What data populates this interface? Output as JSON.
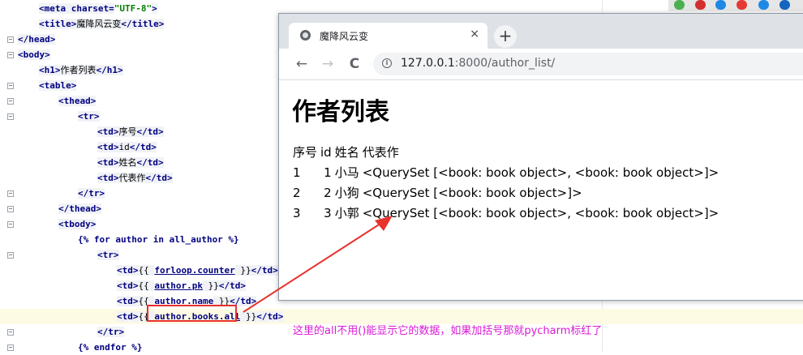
{
  "editor": {
    "lines": [
      {
        "segments": [
          {
            "t": "<meta charset=",
            "c": "tag"
          },
          {
            "t": "\"UTF-8\"",
            "c": "str"
          },
          {
            "t": ">",
            "c": "tag"
          }
        ]
      },
      {
        "segments": [
          {
            "t": "<title>",
            "c": "tag"
          },
          {
            "t": "魔降风云变",
            "c": "txt"
          },
          {
            "t": "</title>",
            "c": "tag"
          }
        ]
      },
      {
        "segments": [
          {
            "t": "</head>",
            "c": "tag"
          }
        ]
      },
      {
        "segments": [
          {
            "t": "<body>",
            "c": "tag"
          }
        ]
      },
      {
        "segments": [
          {
            "t": "<h1>",
            "c": "tag"
          },
          {
            "t": "作者列表",
            "c": "txt"
          },
          {
            "t": "</h1>",
            "c": "tag"
          }
        ]
      },
      {
        "segments": [
          {
            "t": "<table>",
            "c": "tag"
          }
        ]
      },
      {
        "segments": [
          {
            "t": "<thead>",
            "c": "tag"
          }
        ]
      },
      {
        "segments": [
          {
            "t": "<tr>",
            "c": "tag"
          }
        ]
      },
      {
        "segments": [
          {
            "t": "<td>",
            "c": "tag"
          },
          {
            "t": "序号",
            "c": "txt"
          },
          {
            "t": "</td>",
            "c": "tag"
          }
        ]
      },
      {
        "segments": [
          {
            "t": "<td>",
            "c": "tag"
          },
          {
            "t": "id",
            "c": "txt"
          },
          {
            "t": "</td>",
            "c": "tag"
          }
        ]
      },
      {
        "segments": [
          {
            "t": "<td>",
            "c": "tag"
          },
          {
            "t": "姓名",
            "c": "txt"
          },
          {
            "t": "</td>",
            "c": "tag"
          }
        ]
      },
      {
        "segments": [
          {
            "t": "<td>",
            "c": "tag"
          },
          {
            "t": "代表作",
            "c": "txt"
          },
          {
            "t": "</td>",
            "c": "tag"
          }
        ]
      },
      {
        "segments": [
          {
            "t": "</tr>",
            "c": "tag"
          }
        ]
      },
      {
        "segments": [
          {
            "t": "</thead>",
            "c": "tag"
          }
        ]
      },
      {
        "segments": [
          {
            "t": "<tbody>",
            "c": "tag"
          }
        ]
      },
      {
        "segments": [
          {
            "t": "{% for author in all_author %}",
            "c": "tpl"
          }
        ]
      },
      {
        "segments": [
          {
            "t": "<tr>",
            "c": "tag"
          }
        ]
      },
      {
        "segments": [
          {
            "t": "<td>",
            "c": "tag"
          },
          {
            "t": "{{ ",
            "c": "txt"
          },
          {
            "t": "forloop.counter",
            "c": "tplv"
          },
          {
            "t": " }}",
            "c": "txt"
          },
          {
            "t": "</td>",
            "c": "tag"
          }
        ]
      },
      {
        "segments": [
          {
            "t": "<td>",
            "c": "tag"
          },
          {
            "t": "{{ ",
            "c": "txt"
          },
          {
            "t": "author.pk",
            "c": "tplv"
          },
          {
            "t": " }}",
            "c": "txt"
          },
          {
            "t": "</td>",
            "c": "tag"
          }
        ]
      },
      {
        "segments": [
          {
            "t": "<td>",
            "c": "tag"
          },
          {
            "t": "{{ ",
            "c": "txt"
          },
          {
            "t": "author.name",
            "c": "tplv"
          },
          {
            "t": " }}",
            "c": "txt"
          },
          {
            "t": "</td>",
            "c": "tag"
          }
        ]
      },
      {
        "segments": [
          {
            "t": "<td>",
            "c": "tag"
          },
          {
            "t": "{{ ",
            "c": "txt"
          },
          {
            "t": "author.books.all",
            "c": "tplv"
          },
          {
            "t": " }}",
            "c": "txt"
          },
          {
            "t": "</td>",
            "c": "tag"
          }
        ],
        "highlight": true
      },
      {
        "segments": [
          {
            "t": "</tr>",
            "c": "tag"
          }
        ]
      },
      {
        "segments": [
          {
            "t": "{% endfor %}",
            "c": "tpl"
          }
        ]
      }
    ]
  },
  "browser": {
    "tab_title": "魔降风云变",
    "tab_close": "×",
    "new_tab": "+",
    "back": "←",
    "forward": "→",
    "reload": "C",
    "url_host": "127.0.0.1",
    "url_path": ":8000/author_list/",
    "page_heading": "作者列表",
    "table_header": [
      "序号",
      "id",
      "姓名",
      "代表作"
    ],
    "table_rows": [
      [
        "1",
        "1",
        "小马",
        "<QuerySet [<book: book object>, <book: book object>]>"
      ],
      [
        "2",
        "2",
        "小狗",
        "<QuerySet [<book: book object>]>"
      ],
      [
        "3",
        "3",
        "小郭",
        "<QuerySet [<book: book object>, <book: book object>]>"
      ]
    ]
  },
  "annotation": {
    "note": "这里的all不用()能显示它的数据，如果加括号那就pycharm标红了",
    "note_color": "#d81ad3",
    "box_color": "#e8322c"
  },
  "tray_colors": [
    "#4caf50",
    "#d32f2f",
    "#1e88e5",
    "#e53935",
    "#1e88e5",
    "#1565c0"
  ]
}
